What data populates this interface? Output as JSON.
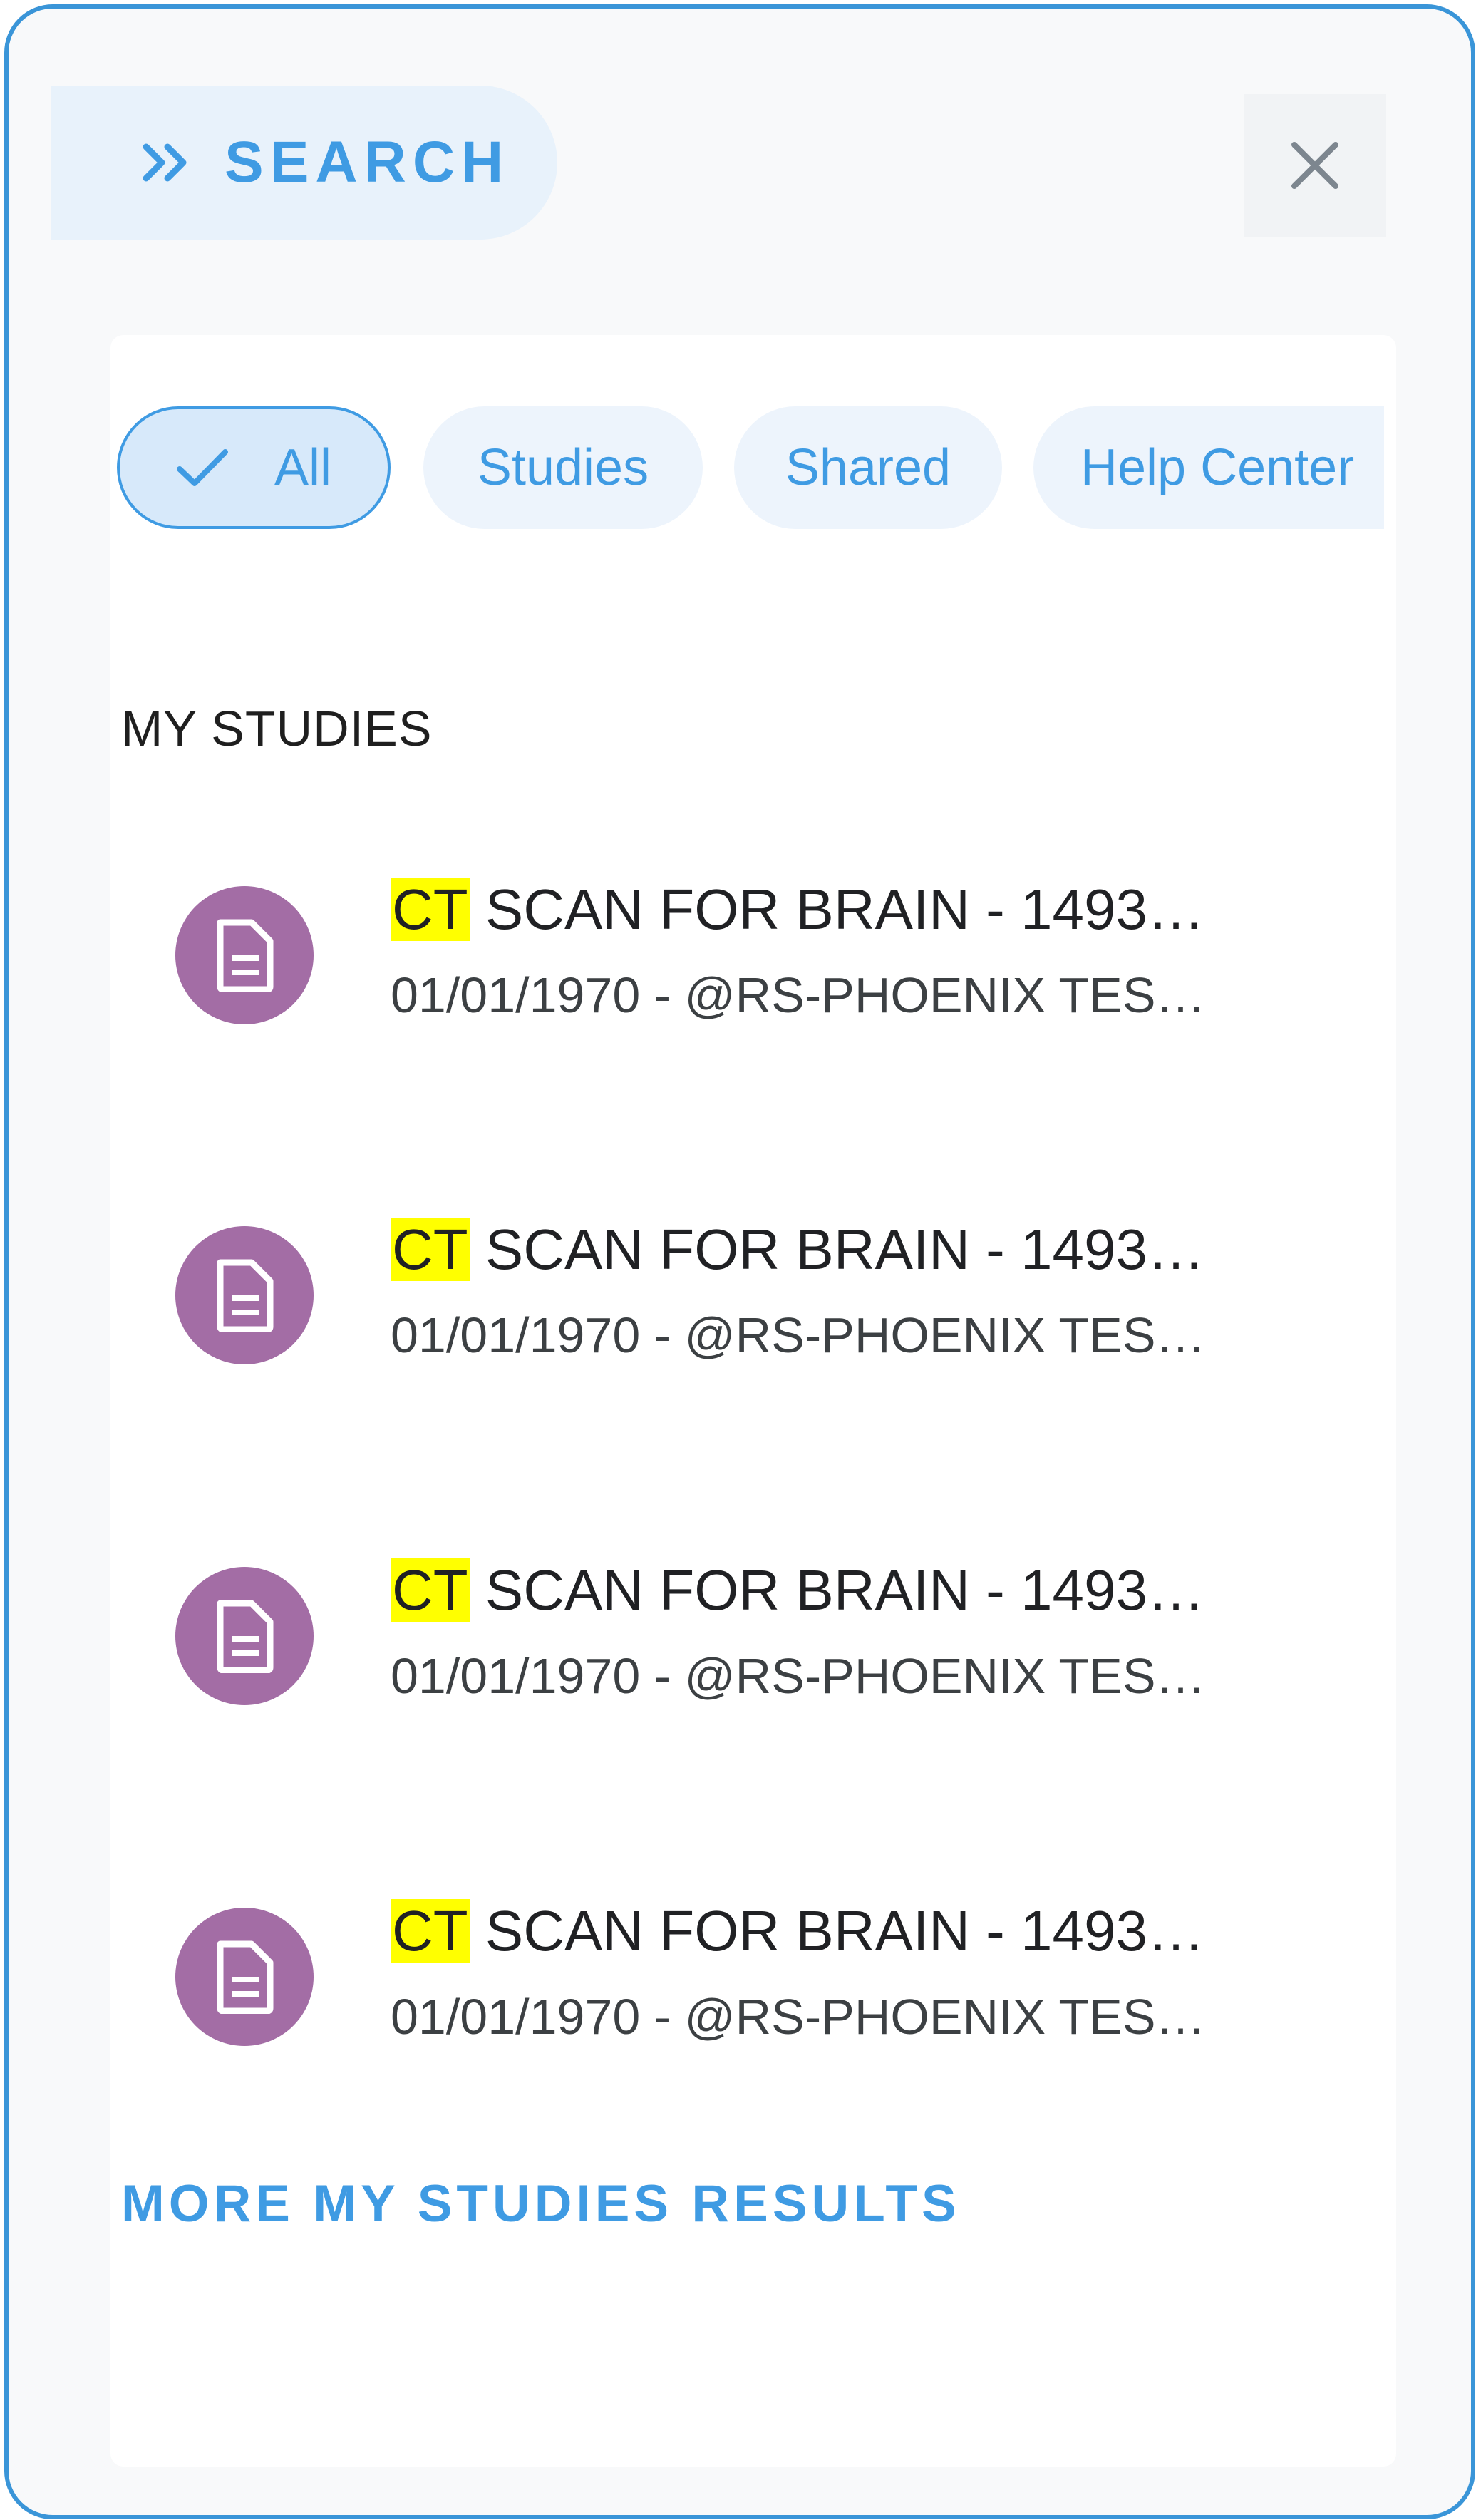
{
  "header": {
    "search_label": "SEARCH",
    "expand_icon": "double-chevron-right-icon",
    "close_icon": "close-icon"
  },
  "filters": {
    "chips": [
      {
        "label": "All",
        "selected": true,
        "icon": "check-icon"
      },
      {
        "label": "Studies",
        "selected": false
      },
      {
        "label": "Shared",
        "selected": false
      },
      {
        "label": "Help Center",
        "selected": false
      }
    ]
  },
  "section": {
    "title": "MY STUDIES"
  },
  "results": [
    {
      "highlight": "CT",
      "title_rest": " SCAN FOR BRAIN - 1493…",
      "subtitle": "01/01/1970 - @RS-PHOENIX TES…",
      "icon": "document-icon"
    },
    {
      "highlight": "CT",
      "title_rest": " SCAN FOR BRAIN - 1493…",
      "subtitle": "01/01/1970 - @RS-PHOENIX TES…",
      "icon": "document-icon"
    },
    {
      "highlight": "CT",
      "title_rest": " SCAN FOR BRAIN - 1493…",
      "subtitle": "01/01/1970 - @RS-PHOENIX TES…",
      "icon": "document-icon"
    },
    {
      "highlight": "CT",
      "title_rest": " SCAN FOR BRAIN - 1493…",
      "subtitle": "01/01/1970 - @RS-PHOENIX TES…",
      "icon": "document-icon"
    }
  ],
  "more_link": "MORE MY STUDIES RESULTS",
  "colors": {
    "accent": "#3f9be3",
    "border": "#3a95d8",
    "avatar": "#a36da5",
    "highlight": "#ffff00"
  }
}
